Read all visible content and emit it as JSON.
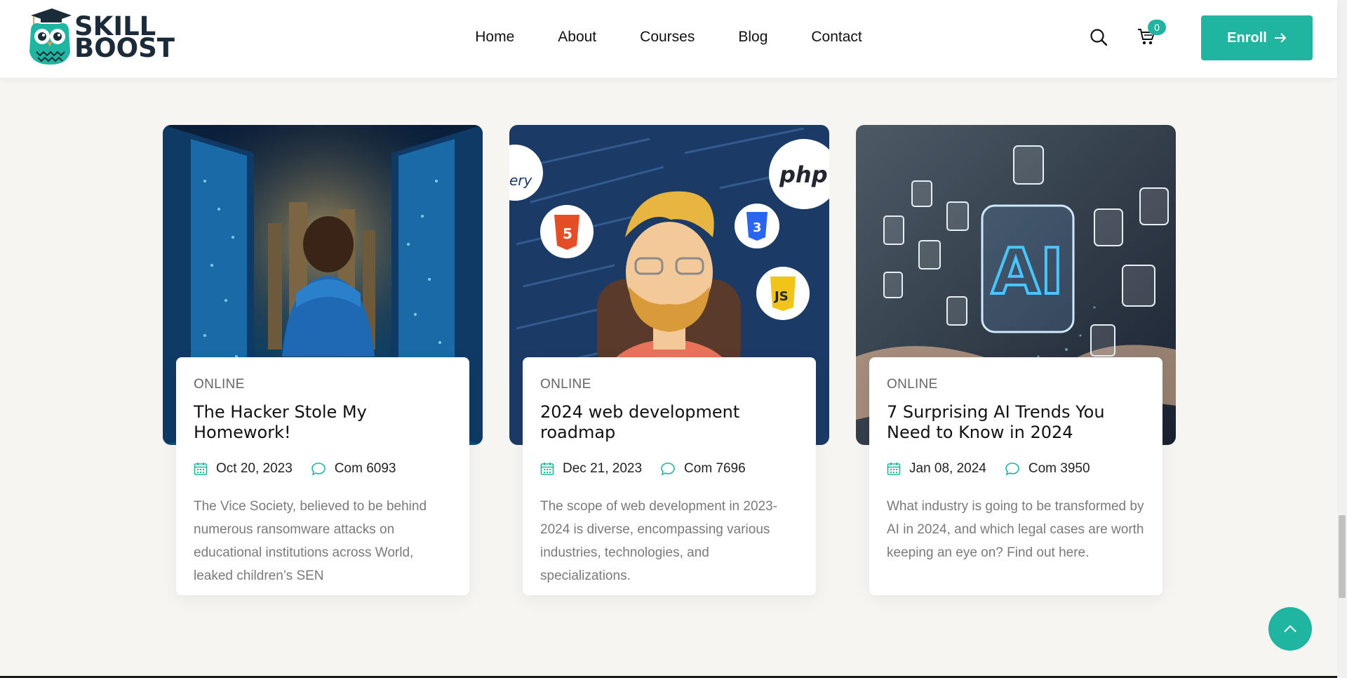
{
  "brand": {
    "name_line1": "SKILL",
    "name_line2": "BOOST",
    "primary_color": "#20b5a0",
    "dark_color": "#1c2b3a"
  },
  "nav": {
    "items": [
      {
        "label": "Home"
      },
      {
        "label": "About"
      },
      {
        "label": "Courses"
      },
      {
        "label": "Blog"
      },
      {
        "label": "Contact"
      }
    ]
  },
  "header_actions": {
    "search_icon": "search-icon",
    "cart_icon": "cart-icon",
    "cart_count": "0",
    "enroll_label": "Enroll"
  },
  "posts": [
    {
      "category": "ONLINE",
      "title": "The Hacker Stole My Homework!",
      "date": "Oct 20, 2023",
      "comments": "Com 6093",
      "excerpt": "The Vice Society, believed to be behind numerous ransomware attacks on educational institutions across World, leaked children’s SEN",
      "image": "boy-in-server-room"
    },
    {
      "category": "ONLINE",
      "title": "2024 web development roadmap",
      "date": "Dec 21, 2023",
      "comments": "Com 7696",
      "excerpt": "The scope of web development in 2023-2024 is diverse, encompassing various industries, technologies, and specializations.",
      "image": "developer-with-tech-logos",
      "badges": {
        "jquery": "ery",
        "php": "php",
        "html5": "5",
        "css3": "3",
        "js": "JS"
      }
    },
    {
      "category": "ONLINE",
      "title": "7 Surprising AI Trends You Need to Know in 2024",
      "date": "Jan 08, 2024",
      "comments": "Com 3950",
      "excerpt": "What industry is going to be transformed by AI in 2024, and which legal cases are worth keeping an eye on? Find out here.",
      "image": "ai-hologram-over-laptop",
      "badges": {
        "ai": "AI"
      }
    }
  ]
}
